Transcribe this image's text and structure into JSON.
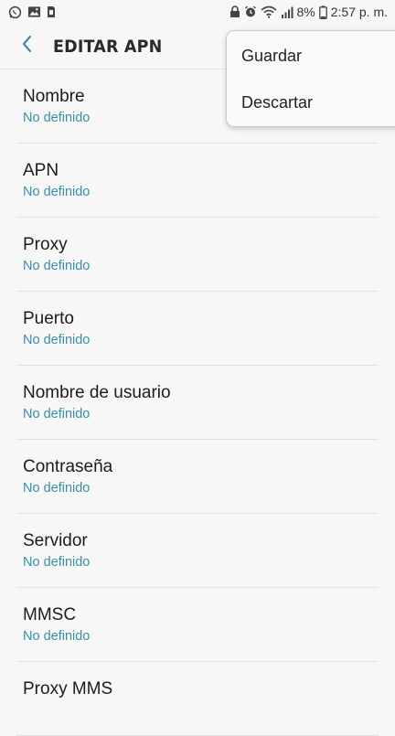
{
  "status_bar": {
    "battery_percent": "8%",
    "time": "2:57 p. m.",
    "left_icons": [
      "whatsapp-icon",
      "image-icon",
      "sim-icon"
    ],
    "right_icons": [
      "lock-icon",
      "alarm-icon",
      "wifi-icon",
      "signal-icon",
      "battery-icon"
    ]
  },
  "header": {
    "title": "EDITAR APN",
    "back_icon": "chevron-left-icon",
    "accent_color": "#3a8fa6"
  },
  "menu": {
    "items": [
      {
        "label": "Guardar"
      },
      {
        "label": "Descartar"
      }
    ]
  },
  "list": {
    "items": [
      {
        "label": "Nombre",
        "value": "No definido"
      },
      {
        "label": "APN",
        "value": "No definido"
      },
      {
        "label": "Proxy",
        "value": "No definido"
      },
      {
        "label": "Puerto",
        "value": "No definido"
      },
      {
        "label": "Nombre de usuario",
        "value": "No definido"
      },
      {
        "label": "Contraseña",
        "value": "No definido"
      },
      {
        "label": "Servidor",
        "value": "No definido"
      },
      {
        "label": "MMSC",
        "value": "No definido"
      },
      {
        "label": "Proxy MMS",
        "value": ""
      }
    ]
  }
}
